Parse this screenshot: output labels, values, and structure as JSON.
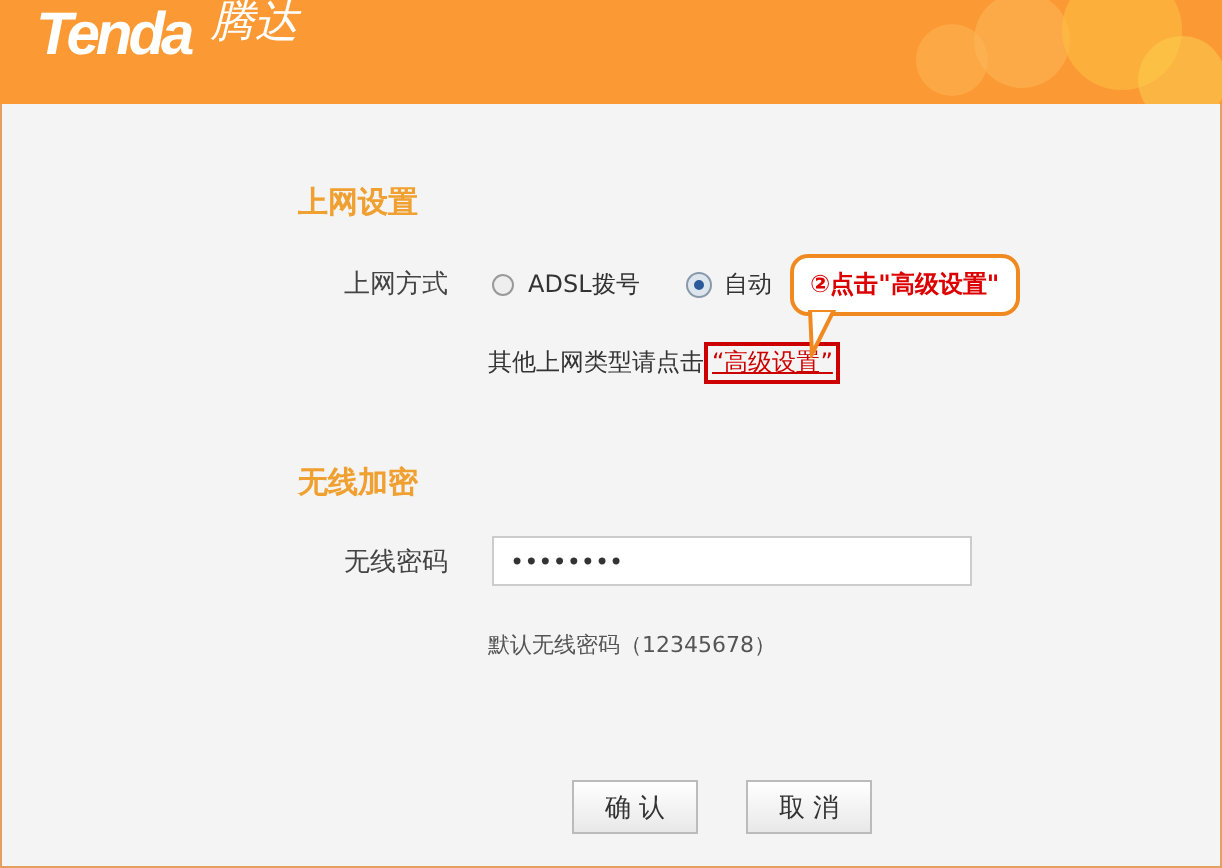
{
  "header": {
    "logo": "Tenda",
    "logo_cn": "腾达"
  },
  "internet": {
    "heading": "上网设置",
    "label": "上网方式",
    "options": [
      {
        "label": "ADSL拨号",
        "selected": false
      },
      {
        "label": "自动",
        "selected": true
      }
    ],
    "hint": "其他上网类型请点击",
    "link": "“高级设置”"
  },
  "callout": "②点击\"高级设置\"",
  "wireless": {
    "heading": "无线加密",
    "label": "无线密码",
    "value": "••••••••",
    "hint": "默认无线密码（12345678）"
  },
  "buttons": [
    "确 认",
    "取 消"
  ]
}
